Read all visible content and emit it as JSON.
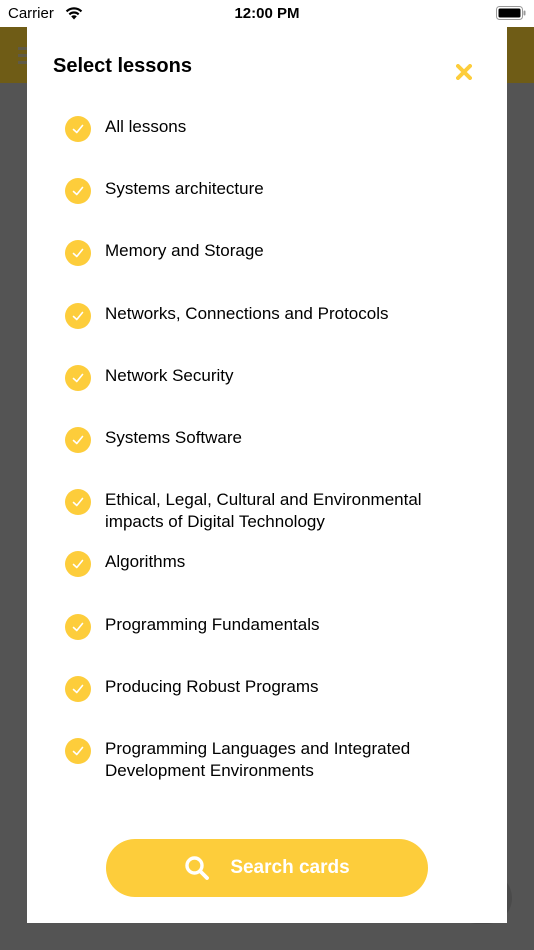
{
  "status_bar": {
    "carrier": "Carrier",
    "time": "12:00 PM"
  },
  "modal": {
    "title": "Select lessons",
    "lessons": [
      {
        "label": "All lessons",
        "checked": true
      },
      {
        "label": "Systems architecture",
        "checked": true
      },
      {
        "label": "Memory and Storage",
        "checked": true
      },
      {
        "label": "Networks, Connections and Protocols",
        "checked": true
      },
      {
        "label": "Network Security",
        "checked": true
      },
      {
        "label": "Systems Software",
        "checked": true
      },
      {
        "label": "Ethical, Legal, Cultural and Environmental impacts of Digital Technology",
        "checked": true
      },
      {
        "label": "Algorithms",
        "checked": true
      },
      {
        "label": "Programming Fundamentals",
        "checked": true
      },
      {
        "label": "Producing Robust Programs",
        "checked": true
      },
      {
        "label": "Programming Languages and Integrated Development Environments",
        "checked": true
      }
    ],
    "search_button_label": "Search cards"
  },
  "icons": {
    "close": "close-icon",
    "check": "checkmark-icon",
    "search": "search-icon",
    "menu": "hamburger-menu-icon",
    "wifi": "wifi-icon",
    "battery": "battery-icon"
  },
  "colors": {
    "accent": "#fdcd3b",
    "overlay": "#545454",
    "header_dimmed": "#6f5c16",
    "surface": "#ffffff",
    "text": "#000000",
    "button_text": "#ffffff"
  }
}
